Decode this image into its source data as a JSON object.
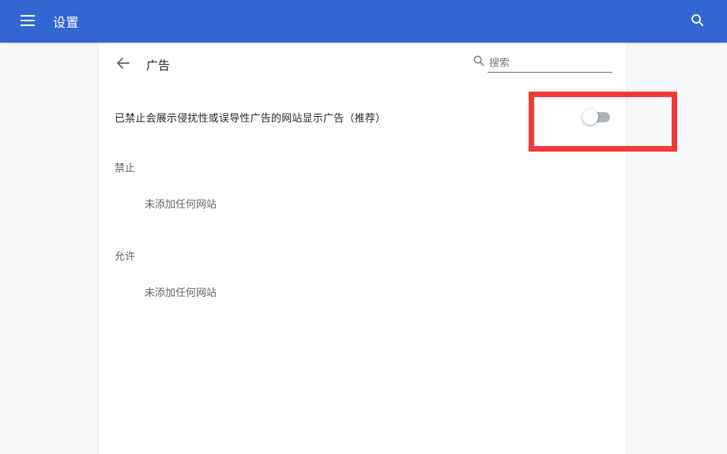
{
  "header": {
    "title": "设置",
    "icons": {
      "menu": "hamburger-icon",
      "search": "search-icon"
    }
  },
  "subheader": {
    "title": "广告",
    "back_icon": "arrow-back-icon",
    "search_placeholder": "搜索",
    "search_value": ""
  },
  "main": {
    "toggle_label": "已禁止会展示侵扰性或误导性广告的网站显示广告（推荐）",
    "toggle_state": "off",
    "sections": [
      {
        "title": "禁止",
        "empty_text": "未添加任何网站"
      },
      {
        "title": "允许",
        "empty_text": "未添加任何网站"
      }
    ]
  },
  "annotation": {
    "shape": "rectangle",
    "color": "#f43a38",
    "target": "ads-toggle"
  },
  "colors": {
    "toolbar_blue": "#3366d0",
    "page_background": "#f7f8fa",
    "card_background": "#ffffff",
    "toggle_track_off": "#b0b5bb",
    "primary_text": "#202124",
    "secondary_text": "#5f6368"
  }
}
